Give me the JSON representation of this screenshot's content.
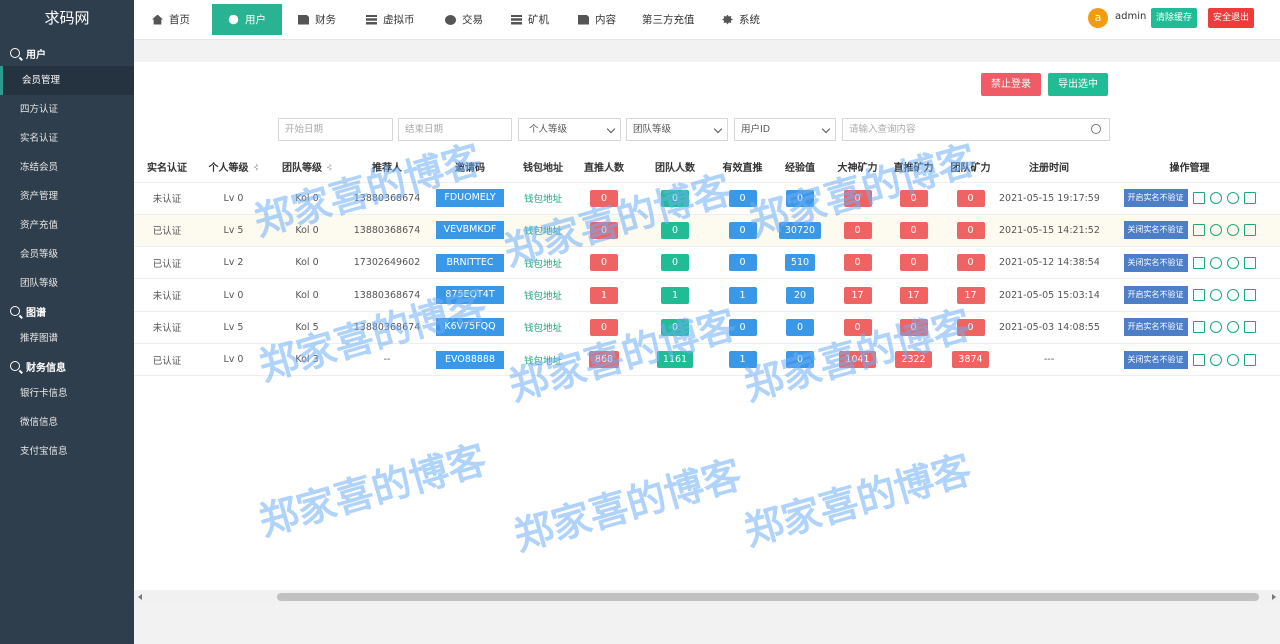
{
  "sidebar": {
    "logo": "求码网",
    "groups": [
      {
        "title": "用户",
        "items": [
          "会员管理",
          "四方认证",
          "实名认证",
          "冻结会员",
          "资产管理",
          "资产充值",
          "会员等级",
          "团队等级"
        ]
      },
      {
        "title": "图谱",
        "items": [
          "推荐图谱"
        ]
      },
      {
        "title": "财务信息",
        "items": [
          "银行卡信息",
          "微信信息",
          "支付宝信息"
        ]
      }
    ]
  },
  "topnav": {
    "items": [
      "首页",
      "用户",
      "财务",
      "虚拟币",
      "交易",
      "矿机",
      "内容",
      "第三方充值",
      "系统"
    ],
    "user_initial": "a",
    "username": "admin",
    "clear_cache": "清除缓存",
    "logout": "安全退出"
  },
  "actions": {
    "ban_login": "禁止登录",
    "export": "导出选中"
  },
  "filters": {
    "start_date": "开始日期",
    "end_date": "结束日期",
    "personal_level": "个人等级",
    "team_level": "团队等级",
    "user_id": "用户ID",
    "search": "请输入查询内容"
  },
  "table": {
    "headers": [
      "实名认证",
      "个人等级",
      "团队等级",
      "推荐人",
      "邀请码",
      "钱包地址",
      "直推人数",
      "团队人数",
      "有效直推",
      "经验值",
      "大神矿力",
      "直推矿力",
      "团队矿力",
      "注册时间",
      "操作管理"
    ],
    "rows": [
      {
        "real": "未认证",
        "plevel": "Lv 0",
        "tlevel": "Kol 0",
        "ref": "13880368674",
        "code": "FDUOMELY",
        "wallet": "钱包地址",
        "direct": "0",
        "team": "0",
        "valid": "0",
        "exp": "0",
        "god": "0",
        "dpower": "0",
        "tpower": "0",
        "time": "2021-05-15 19:17:59",
        "op": "开启实名不验证"
      },
      {
        "real": "已认证",
        "plevel": "Lv 5",
        "tlevel": "Kol 0",
        "ref": "13880368674",
        "code": "VEVBMKDF",
        "wallet": "钱包地址",
        "direct": "0",
        "team": "0",
        "valid": "0",
        "exp": "30720",
        "god": "0",
        "dpower": "0",
        "tpower": "0",
        "time": "2021-05-15 14:21:52",
        "op": "关闭实名不验证"
      },
      {
        "real": "已认证",
        "plevel": "Lv 2",
        "tlevel": "Kol 0",
        "ref": "17302649602",
        "code": "BRNITTEC",
        "wallet": "钱包地址",
        "direct": "0",
        "team": "0",
        "valid": "0",
        "exp": "510",
        "god": "0",
        "dpower": "0",
        "tpower": "0",
        "time": "2021-05-12 14:38:54",
        "op": "关闭实名不验证"
      },
      {
        "real": "未认证",
        "plevel": "Lv 0",
        "tlevel": "Kol 0",
        "ref": "13880368674",
        "code": "875EQT4T",
        "wallet": "钱包地址",
        "direct": "1",
        "team": "1",
        "valid": "1",
        "exp": "20",
        "god": "17",
        "dpower": "17",
        "tpower": "17",
        "time": "2021-05-05 15:03:14",
        "op": "开启实名不验证"
      },
      {
        "real": "未认证",
        "plevel": "Lv 5",
        "tlevel": "Kol 5",
        "ref": "13880368674",
        "code": "K6V75FQQ",
        "wallet": "钱包地址",
        "direct": "0",
        "team": "0",
        "valid": "0",
        "exp": "0",
        "god": "0",
        "dpower": "0",
        "tpower": "0",
        "time": "2021-05-03 14:08:55",
        "op": "开启实名不验证"
      },
      {
        "real": "已认证",
        "plevel": "Lv 0",
        "tlevel": "Kol 3",
        "ref": "--",
        "code": "EVO88888",
        "wallet": "钱包地址",
        "direct": "868",
        "team": "1161",
        "valid": "1",
        "exp": "0",
        "god": "1041",
        "dpower": "2322",
        "tpower": "3874",
        "time": "---",
        "op": "关闭实名不验证"
      }
    ]
  },
  "watermark": "郑家喜的博客",
  "colors": {
    "accent": "#2ab393",
    "sidebar": "#2f3e4c",
    "red": "#ef6363",
    "green": "#1fbc95",
    "blue": "#3a98e8"
  }
}
